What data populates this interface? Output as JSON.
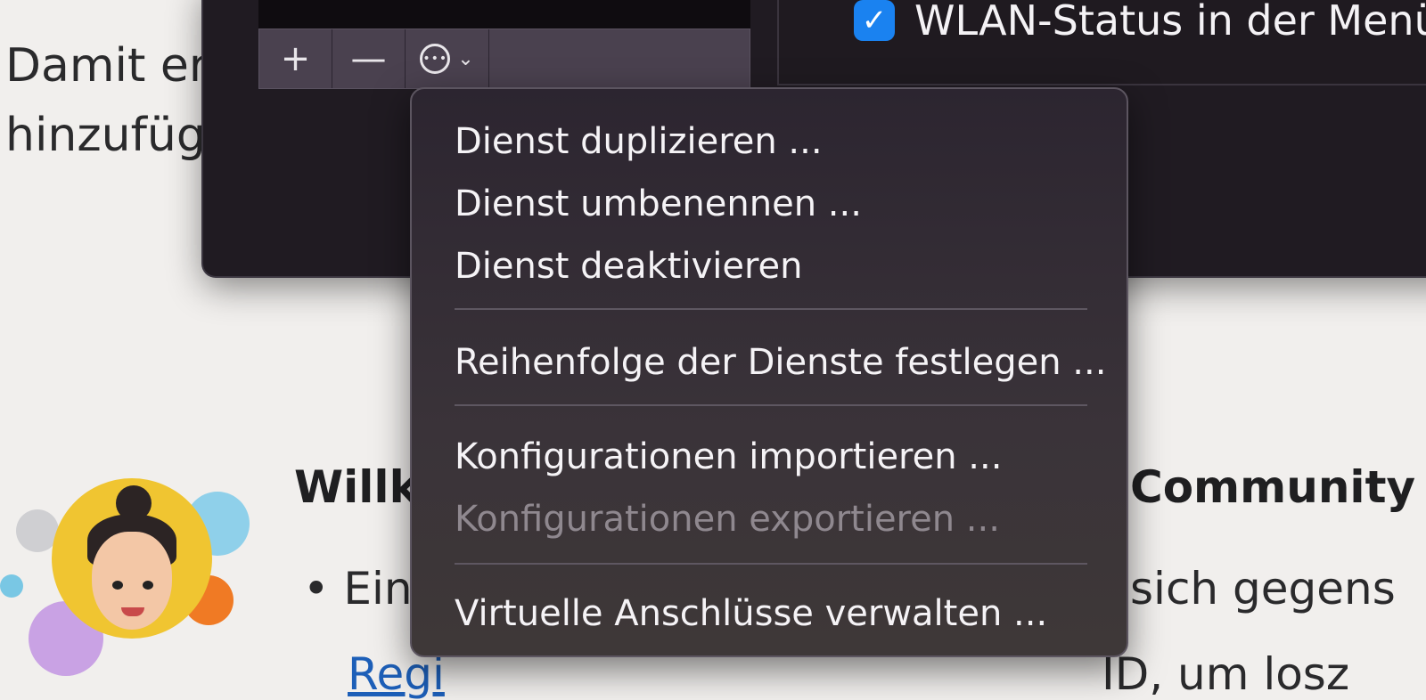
{
  "background_page": {
    "line1": "Damit er",
    "line2": "hinzufüg",
    "heading_left": "Willk",
    "heading_right": "Community",
    "bullet_left": "Ein",
    "bullet_right": "sich gegens",
    "link_left": "Regi",
    "link_right": "ID, um losz"
  },
  "window": {
    "toolbar": {
      "add_label": "+",
      "remove_label": "—",
      "action_icon": "ellipsis-circle-icon",
      "action_chevron": "chevron-down-icon"
    },
    "wlan_checkbox": {
      "checked": true,
      "label": "WLAN-Status in der Menül"
    }
  },
  "context_menu": {
    "items": [
      {
        "label": "Dienst duplizieren ...",
        "enabled": true
      },
      {
        "label": "Dienst umbenennen ...",
        "enabled": true
      },
      {
        "label": "Dienst deaktivieren",
        "enabled": true
      },
      {
        "label": "Reihenfolge der Dienste festlegen ...",
        "enabled": true
      },
      {
        "label": "Konfigurationen importieren ...",
        "enabled": true
      },
      {
        "label": "Konfigurationen exportieren ...",
        "enabled": false
      },
      {
        "label": "Virtuelle Anschlüsse verwalten ...",
        "enabled": true
      }
    ]
  },
  "colors": {
    "window_bg": "#201b22",
    "menu_bg": "#3a3339",
    "checkbox_accent": "#1a82f0",
    "link": "#1d5fb8"
  }
}
